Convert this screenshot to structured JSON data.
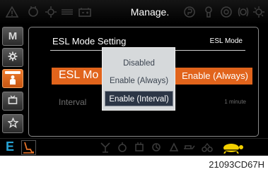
{
  "header": {
    "title": "Manage.",
    "icons": [
      "warning-icon",
      "engine-oil-icon",
      "coolant-temp-icon",
      "fuel-level-icon",
      "battery-icon",
      "brake-icon",
      "glow-plug-icon",
      "overheat-icon",
      "circle-icon",
      "hydraulic-icon"
    ]
  },
  "sidebar": {
    "items": [
      {
        "label": "M",
        "icon": "mode-icon",
        "active": false
      },
      {
        "label": "",
        "icon": "gear-icon",
        "active": false
      },
      {
        "label": "",
        "icon": "person-icon",
        "active": true
      },
      {
        "label": "",
        "icon": "display-icon",
        "active": false
      },
      {
        "label": "",
        "icon": "star-icon",
        "active": false
      }
    ]
  },
  "panel": {
    "title": "ESL Mode Setting",
    "tag": "ESL Mode",
    "esl_label": "ESL Mo",
    "esl_value": "Enable (Always)",
    "interval_label": "Interval",
    "interval_value": "1 minute"
  },
  "popup": {
    "options": [
      {
        "label": "Disabled",
        "selected": false
      },
      {
        "label": "Enable (Always)",
        "selected": false
      },
      {
        "label": "Enable (Interval)",
        "selected": true
      }
    ]
  },
  "bottom_bar": {
    "mode_letter": "E",
    "icons": [
      "auto-idle-icon",
      "attachment-icon",
      "fuel-icon",
      "engine-icon",
      "clutch-icon",
      "speed-icon",
      "turtle-icon"
    ]
  },
  "caption": "21093CD67H",
  "colors": {
    "accent_orange": "#e1641c",
    "mode_blue": "#27a4d6",
    "popup_bg": "#d6d9db",
    "popup_selected": "#2c3646",
    "turtle_yellow": "#f3d000"
  }
}
